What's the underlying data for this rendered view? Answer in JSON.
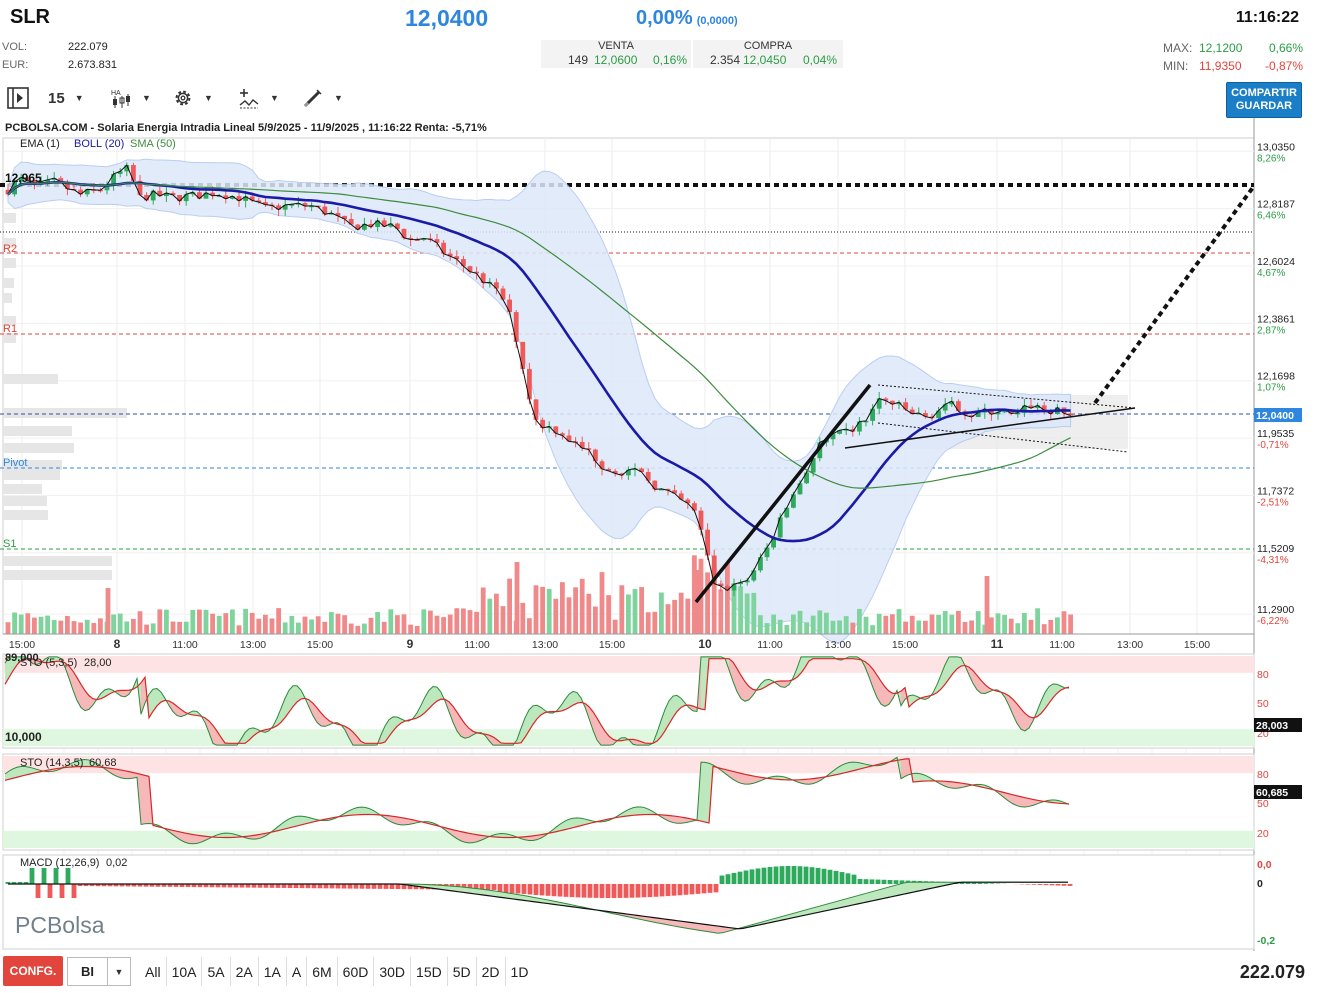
{
  "header": {
    "ticker": "SLR",
    "last_price": "12,0400",
    "change_pct": "0,00%",
    "change_abs": "(0,0000)",
    "time": "11:16:22",
    "vol_label": "VOL:",
    "vol_value": "222.079",
    "eur_label": "EUR:",
    "eur_value": "2.673.831",
    "venta": {
      "label": "VENTA",
      "qty": "149",
      "price": "12,0600",
      "pct": "0,16%"
    },
    "compra": {
      "label": "COMPRA",
      "qty": "2.354",
      "price": "12,0450",
      "pct": "0,04%"
    },
    "max": {
      "label": "MAX:",
      "price": "12,1200",
      "pct": "0,66%"
    },
    "min": {
      "label": "MIN:",
      "price": "11,9350",
      "pct": "-0,87%"
    }
  },
  "toolbar": {
    "interval_value": "15",
    "save_button": "COMPARTIR\nGUARDAR",
    "icons": [
      "panel-toggle-icon",
      "candles-icon",
      "gear-icon",
      "indicators-icon",
      "drawing-pen-icon"
    ]
  },
  "chart": {
    "title": "PCBOLSA.COM - Solaria Energia Intradia Lineal 5/9/2025 - 11/9/2025 , 11:16:22 Renta: -5,71%",
    "legend": {
      "ema": "EMA (1)",
      "boll": "BOLL (20)",
      "sma": "SMA (50)"
    },
    "high_marker": "12,965",
    "levels": {
      "r2": "R2",
      "r1": "R1",
      "pivot": "Pivot",
      "s1": "S1"
    },
    "price_axis": [
      {
        "p": "13,0350",
        "c": "8,26%"
      },
      {
        "p": "12,8187",
        "c": "6,46%"
      },
      {
        "p": "12,6024",
        "c": "4,67%"
      },
      {
        "p": "12,3861",
        "c": "2,87%"
      },
      {
        "p": "12,1698",
        "c": "1,07%"
      },
      {
        "p": "11,9535",
        "c": "-0,71%"
      },
      {
        "p": "11,7372",
        "c": "-2,51%"
      },
      {
        "p": "11,5209",
        "c": "-4,31%"
      },
      {
        "p": "11,2900",
        "c": "-6,22%"
      }
    ],
    "current_price_tag": "12,0400",
    "time_axis": [
      "15:00",
      "8",
      "11:00",
      "13:00",
      "15:00",
      "9",
      "11:00",
      "13:00",
      "15:00",
      "10",
      "11:00",
      "13:00",
      "15:00",
      "11",
      "11:00",
      "13:00",
      "15:00"
    ],
    "sto1": {
      "label": "STO (5,3,5)",
      "value": "28,00",
      "top_label": "89,000",
      "bottom_label": "10,000",
      "tag": "28,003",
      "ticks": [
        "80",
        "50",
        "20"
      ]
    },
    "sto2": {
      "label": "STO (14,3,5)",
      "value": "60,68",
      "tag": "60,685",
      "ticks": [
        "80",
        "50",
        "20"
      ]
    },
    "macd": {
      "label": "MACD (12,26,9)",
      "value": "0,02",
      "ticks": [
        "0,0",
        "0",
        "-0,2"
      ]
    },
    "watermark": "PCBolsa",
    "colors": {
      "up": "#2eaa5c",
      "down": "#ee5a5a",
      "ema": "#1a1aa6",
      "sma": "#3c8c3c",
      "band": "#dde8fa",
      "price": "#2f86de"
    }
  },
  "bottom": {
    "config_button": "CONFG.",
    "type_value": "BI",
    "ranges": [
      "All",
      "10A",
      "5A",
      "2A",
      "1A",
      "A",
      "6M",
      "60D",
      "30D",
      "15D",
      "5D",
      "2D",
      "1D"
    ],
    "total_volume": "222.079"
  }
}
